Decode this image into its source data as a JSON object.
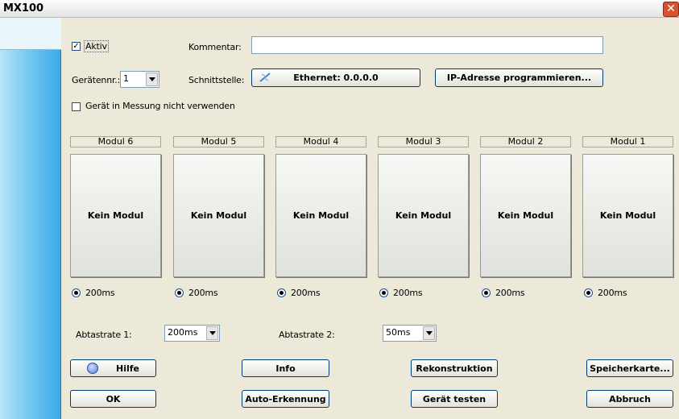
{
  "window": {
    "title": "MX100"
  },
  "form": {
    "aktiv_label": "Aktiv",
    "aktiv_checked": true,
    "kommentar_label": "Kommentar:",
    "kommentar_value": "",
    "geraetenr_label": "Gerätennr.:",
    "geraetenr_value": "1",
    "schnittstelle_label": "Schnittstelle:",
    "schnittstelle_button": "Ethernet: 0.0.0.0",
    "ip_program_button": "IP-Adresse programmieren...",
    "nicht_verwenden_label": "Gerät in Messung nicht verwenden",
    "nicht_verwenden_checked": false
  },
  "modules": [
    {
      "header": "Modul 6",
      "content": "Kein Modul",
      "rate": "200ms"
    },
    {
      "header": "Modul 5",
      "content": "Kein Modul",
      "rate": "200ms"
    },
    {
      "header": "Modul 4",
      "content": "Kein Modul",
      "rate": "200ms"
    },
    {
      "header": "Modul 3",
      "content": "Kein Modul",
      "rate": "200ms"
    },
    {
      "header": "Modul 2",
      "content": "Kein Modul",
      "rate": "200ms"
    },
    {
      "header": "Modul 1",
      "content": "Kein Modul",
      "rate": "200ms"
    }
  ],
  "sampling": {
    "rate1_label": "Abtastrate 1:",
    "rate1_value": "200ms",
    "rate2_label": "Abtastrate 2:",
    "rate2_value": "50ms"
  },
  "buttons": {
    "hilfe": "Hilfe",
    "info": "Info",
    "rekonstruktion": "Rekonstruktion",
    "speicherkarte": "Speicherkarte...",
    "ok": "OK",
    "auto_erkennung": "Auto-Erkennung",
    "geraet_testen": "Gerät testen",
    "abbruch": "Abbruch"
  },
  "icons": {
    "close": "close-icon",
    "network": "network-icon",
    "help": "help-icon"
  }
}
